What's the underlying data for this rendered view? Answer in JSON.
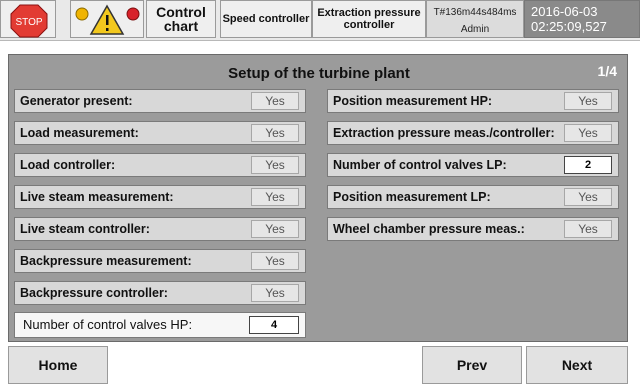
{
  "topbar": {
    "stop_label": "STOP",
    "control_chart": "Control chart",
    "speed_controller": "Speed controller",
    "extraction_controller": "Extraction pressure controller",
    "runtime": "T#136m44s484ms",
    "user": "Admin",
    "date": "2016-06-03",
    "time": "02:25:09,527"
  },
  "panel": {
    "title": "Setup of the turbine plant",
    "page": "1/4",
    "left_rows": [
      {
        "label": "Generator present:",
        "value": "Yes"
      },
      {
        "label": "Load measurement:",
        "value": "Yes"
      },
      {
        "label": "Load controller:",
        "value": "Yes"
      },
      {
        "label": "Live steam measurement:",
        "value": "Yes"
      },
      {
        "label": "Live steam controller:",
        "value": "Yes"
      },
      {
        "label": "Backpressure measurement:",
        "value": "Yes"
      },
      {
        "label": "Backpressure controller:",
        "value": "Yes"
      },
      {
        "label": "Number of control valves HP:",
        "value": "4"
      }
    ],
    "right_rows": [
      {
        "label": "Position measurement HP:",
        "value": "Yes"
      },
      {
        "label": "Extraction pressure meas./controller:",
        "value": "Yes"
      },
      {
        "label": "Number of control valves LP:",
        "value": "2"
      },
      {
        "label": "Position measurement LP:",
        "value": "Yes"
      },
      {
        "label": "Wheel chamber pressure meas.:",
        "value": "Yes"
      }
    ]
  },
  "bottom": {
    "home": "Home",
    "prev": "Prev",
    "next": "Next"
  },
  "colors": {
    "stop_red": "#e23b33",
    "warning_yellow": "#f2c81e",
    "alarm_orange": "#f0b400",
    "alarm_red": "#d8222a",
    "panel_gray": "#9b9b9b"
  },
  "icons": [
    "stop-sign-icon",
    "warning-triangle-icon",
    "alarm-lamp-icon"
  ]
}
